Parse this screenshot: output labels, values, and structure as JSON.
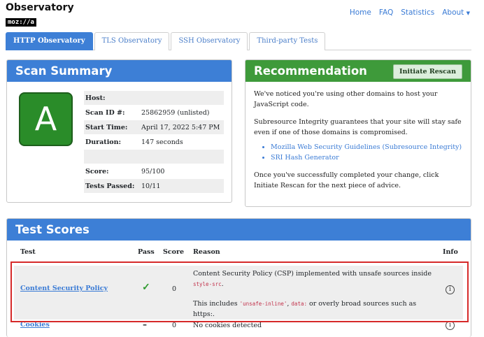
{
  "header": {
    "title": "Observatory",
    "brand": "moz://a",
    "nav": [
      "Home",
      "FAQ",
      "Statistics",
      "About"
    ]
  },
  "tabs": [
    "HTTP Observatory",
    "TLS Observatory",
    "SSH Observatory",
    "Third-party Tests"
  ],
  "scan_summary": {
    "title": "Scan Summary",
    "grade": "A",
    "rows": [
      {
        "label": "Host:",
        "value": ""
      },
      {
        "label": "Scan ID #:",
        "value": "25862959 (unlisted)"
      },
      {
        "label": "Start Time:",
        "value": "April 17, 2022 5:47 PM"
      },
      {
        "label": "Duration:",
        "value": "147 seconds"
      },
      {
        "label": "",
        "value": ""
      },
      {
        "label": "Score:",
        "value": "95/100"
      },
      {
        "label": "Tests Passed:",
        "value": "10/11"
      }
    ]
  },
  "recommendation": {
    "title": "Recommendation",
    "button": "Initiate Rescan",
    "p1": "We've noticed you're using other domains to host your JavaScript code.",
    "p2": "Subresource Integrity guarantees that your site will stay safe even if one of those domains is compromised.",
    "links": [
      "Mozilla Web Security Guidelines (Subresource Integrity)",
      "SRI Hash Generator"
    ],
    "p3": "Once you've successfully completed your change, click Initiate Rescan for the next piece of advice."
  },
  "test_scores": {
    "title": "Test Scores",
    "columns": [
      "Test",
      "Pass",
      "Score",
      "Reason",
      "Info"
    ],
    "rows": [
      {
        "test": "Content Security Policy",
        "pass": "✓",
        "score": "0",
        "reason_a": "Content Security Policy (CSP) implemented with unsafe sources inside",
        "reason_code": "style-src",
        "reason_b": "This includes",
        "code1": "'unsafe-inline'",
        "code2": "data:",
        "reason_c": "or overly broad sources such as https:."
      },
      {
        "test": "Cookies",
        "pass": "–",
        "score": "0",
        "reason": "No cookies detected"
      }
    ]
  },
  "colors": {
    "primary": "#3d7fd6",
    "success": "#3e9a3a",
    "grade": "#2a8c29",
    "highlight": "#d62a2a"
  }
}
